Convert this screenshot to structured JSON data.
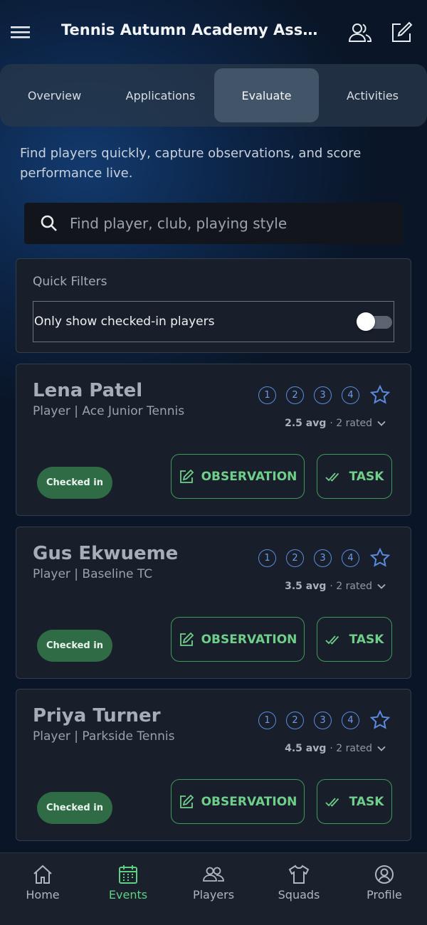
{
  "header": {
    "title": "Tennis Autumn Academy Assessment"
  },
  "tabs": [
    {
      "label": "Overview",
      "active": false
    },
    {
      "label": "Applications",
      "active": false
    },
    {
      "label": "Evaluate",
      "active": true
    },
    {
      "label": "Activities",
      "active": false
    }
  ],
  "intro": "Find players quickly, capture observations, and score performance live.",
  "search": {
    "placeholder": "Find player, club, playing style",
    "value": ""
  },
  "filters": {
    "label": "Quick Filters",
    "checked_in_only": {
      "label": "Only show checked-in players",
      "enabled": false
    }
  },
  "rating_options": [
    "1",
    "2",
    "3",
    "4"
  ],
  "players": [
    {
      "name": "Lena Patel",
      "subtitle": "Player | Ace Junior Tennis",
      "avg": "2.5 avg",
      "rated": "· 2 rated",
      "status": "Checked in",
      "observation_label": "OBSERVATION",
      "task_label": "TASK"
    },
    {
      "name": "Gus Ekwueme",
      "subtitle": "Player | Baseline TC",
      "avg": "3.5 avg",
      "rated": "· 2 rated",
      "status": "Checked in",
      "observation_label": "OBSERVATION",
      "task_label": "TASK"
    },
    {
      "name": "Priya Turner",
      "subtitle": "Player | Parkside Tennis",
      "avg": "4.5 avg",
      "rated": "· 2 rated",
      "status": "Checked in",
      "observation_label": "OBSERVATION",
      "task_label": "TASK"
    }
  ],
  "bottom_nav": [
    {
      "label": "Home",
      "icon": "home-icon",
      "active": false
    },
    {
      "label": "Events",
      "icon": "calendar-icon",
      "active": true
    },
    {
      "label": "Players",
      "icon": "players-icon",
      "active": false
    },
    {
      "label": "Squads",
      "icon": "shirt-icon",
      "active": false
    },
    {
      "label": "Profile",
      "icon": "profile-icon",
      "active": false
    }
  ],
  "colors": {
    "accent_green": "#5fcf80",
    "badge_green": "#2f6b45",
    "rating_blue": "#5b8be0",
    "background": "#0a1628",
    "card": "#181f2a"
  }
}
